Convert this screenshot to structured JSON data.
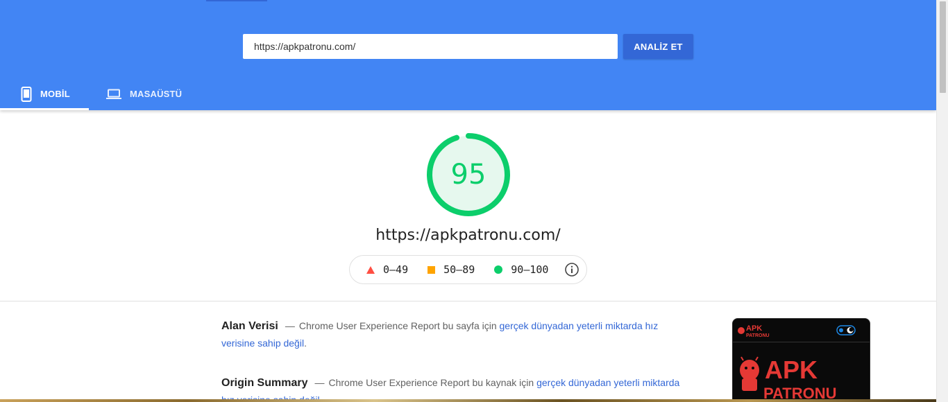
{
  "header": {
    "url_value": "https://apkpatronu.com/",
    "analyze_label": "ANALİZ ET",
    "background_color": "#4285f4",
    "button_color": "#3367d6"
  },
  "tabs": [
    {
      "label": "MOBİL",
      "icon": "smartphone-icon",
      "active": true
    },
    {
      "label": "MASAÜSTÜ",
      "icon": "laptop-icon",
      "active": false
    }
  ],
  "score": {
    "value": "95",
    "fraction": 0.95,
    "color": "#0cce6b",
    "url": "https://apkpatronu.com/"
  },
  "legend": [
    {
      "range": "0–49",
      "shape": "triangle",
      "color": "#ff4e42"
    },
    {
      "range": "50–89",
      "shape": "square",
      "color": "#ffa400"
    },
    {
      "range": "90–100",
      "shape": "circle",
      "color": "#0cce6b"
    }
  ],
  "sections": [
    {
      "title": "Alan Verisi",
      "dash": "—",
      "text": "Chrome User Experience Report bu sayfa için",
      "link": "gerçek dünyadan yeterli miktarda hız verisine sahip değil",
      "end": "."
    },
    {
      "title": "Origin Summary",
      "dash": "—",
      "text": "Chrome User Experience Report bu kaynak için",
      "link": "gerçek dünyadan yeterli miktarda hız verisine sahip değil",
      "end": "."
    }
  ],
  "thumbnail": {
    "logo_small": "APK PATRONU",
    "logo_line1": "APK",
    "logo_line2": "PATRONU",
    "brand_color": "#e53935"
  }
}
